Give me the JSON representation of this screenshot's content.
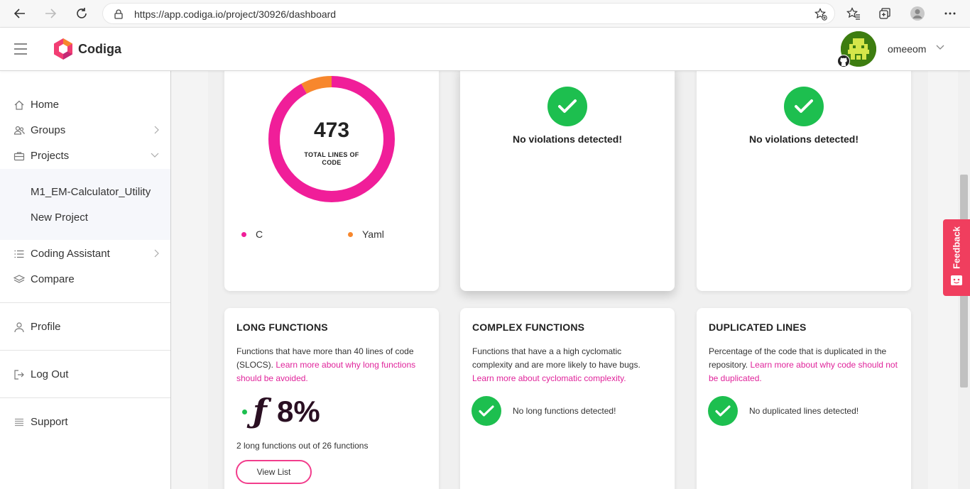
{
  "browser": {
    "url": "https://app.codiga.io/project/30926/dashboard"
  },
  "header": {
    "brand": "Codiga",
    "username": "omeeom"
  },
  "sidebar": {
    "items": [
      {
        "label": "Home"
      },
      {
        "label": "Groups"
      },
      {
        "label": "Projects"
      }
    ],
    "projects": [
      {
        "label": "M1_EM-Calculator_Utility"
      },
      {
        "label": "New Project"
      }
    ],
    "items2": [
      {
        "label": "Coding Assistant"
      },
      {
        "label": "Compare"
      }
    ],
    "profile": "Profile",
    "logout": "Log Out",
    "support": "Support"
  },
  "chart_data": {
    "type": "pie",
    "center_value": "473",
    "center_label": "TOTAL LINES OF CODE",
    "categories": [
      "C",
      "Yaml"
    ],
    "values": [
      92,
      8
    ],
    "colors": [
      "#f01e99",
      "#f7872d"
    ]
  },
  "violations": {
    "card2_message": "No violations detected!",
    "card3_message": "No violations detected!"
  },
  "long_functions": {
    "title": "LONG FUNCTIONS",
    "desc": "Functions that have more than 40 lines of code (SLOCS). ",
    "link": "Learn more about why long functions should be avoided.",
    "percent": "8%",
    "summary": "2 long functions out of 26 functions",
    "button": "View List"
  },
  "complex_functions": {
    "title": "COMPLEX FUNCTIONS",
    "desc": "Functions that have a a high cyclomatic complexity and are more likely to have bugs. ",
    "link": "Learn more about cyclomatic complexity.",
    "message": "No long functions detected!"
  },
  "duplicated_lines": {
    "title": "DUPLICATED LINES",
    "desc": "Percentage of the code that is duplicated in the repository. ",
    "link": "Learn more about why code should not be duplicated.",
    "message": "No duplicated lines detected!"
  },
  "feedback": "Feedback"
}
